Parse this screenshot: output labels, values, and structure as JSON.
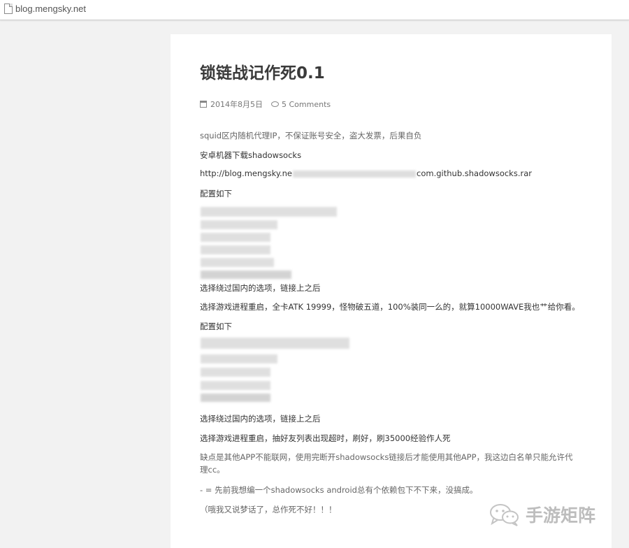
{
  "browser": {
    "url": "blog.mengsky.net"
  },
  "post": {
    "title": "锁链战记作死0.1",
    "date": "2014年8月5日",
    "comments": "5 Comments",
    "lines": {
      "l1": "squid区内随机代理IP，不保证账号安全，盗大发票，后果自负",
      "l2": "安卓机器下载shadowsocks",
      "l3a": "http://blog.mengsky.ne",
      "l3b": "com.github.shadowsocks.rar",
      "l4": "配置如下",
      "l5": "选择绕过国内的选项，链接上之后",
      "l6": "选择游戏进程重启，全卡ATK 19999，怪物破五道，100%装同一么的，就算10000WAVE我也艹给你看。",
      "l7": "配置如下",
      "l8": "选择绕过国内的选项，链接上之后",
      "l9": "选择游戏进程重启，抽好友列表出现超时，刷好，刷35000经验作人死",
      "l10": "缺点是其他APP不能联网，使用完断开shadowsocks链接后才能使用其他APP，我这边白名单只能允许代理cc。",
      "l11": "- = 先前我想编一个shadowsocks android总有个依赖包下不下来，没搞成。",
      "l12": "（哦我又说梦话了，总作死不好！！！"
    }
  },
  "watermark": {
    "text": "手游矩阵",
    "icon": "wechat-icon"
  },
  "colors": {
    "background": "#f2f2f2",
    "article": "#ffffff",
    "title": "#3a3a3a"
  }
}
